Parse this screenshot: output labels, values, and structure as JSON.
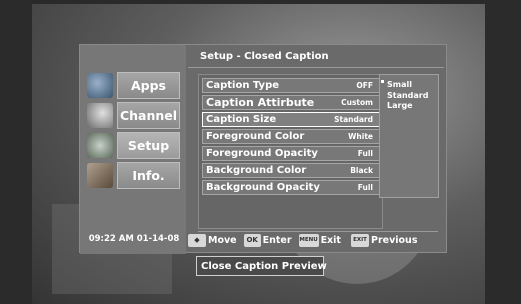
{
  "sidebar": {
    "items": [
      {
        "label": "Apps",
        "icon": "globe-icon",
        "icon_color": "#4a6b8c"
      },
      {
        "label": "Channel",
        "icon": "satellite-dish-icon",
        "icon_color": "#9a9a9a"
      },
      {
        "label": "Setup",
        "icon": "gear-icon",
        "icon_color": "#7a8a7a"
      },
      {
        "label": "Info.",
        "icon": "info-panel-icon",
        "icon_color": "#8a7a6a"
      }
    ],
    "active_item": "Setup",
    "clock": "09:22 AM 01-14-08"
  },
  "title": "Setup - Closed Caption",
  "settings": [
    {
      "label": "Caption Type",
      "value": "OFF"
    },
    {
      "label": "Caption Attirbute",
      "value": "Custom"
    },
    {
      "label": "Caption Size",
      "value": "Standard"
    },
    {
      "label": "Foreground Color",
      "value": "White"
    },
    {
      "label": "Foreground Opacity",
      "value": "Full"
    },
    {
      "label": "Background Color",
      "value": "Black"
    },
    {
      "label": "Background Opacity",
      "value": "Full"
    }
  ],
  "size_options": [
    "Small",
    "Standard",
    "Large"
  ],
  "footer": {
    "move_key": "◆",
    "move_label": "Move",
    "enter_key": "OK",
    "enter_label": "Enter",
    "exit_key": "MENU",
    "exit_label": "Exit",
    "previous_key": "EXIT",
    "previous_label": "Previous"
  },
  "preview_label": "Close Caption Preview"
}
